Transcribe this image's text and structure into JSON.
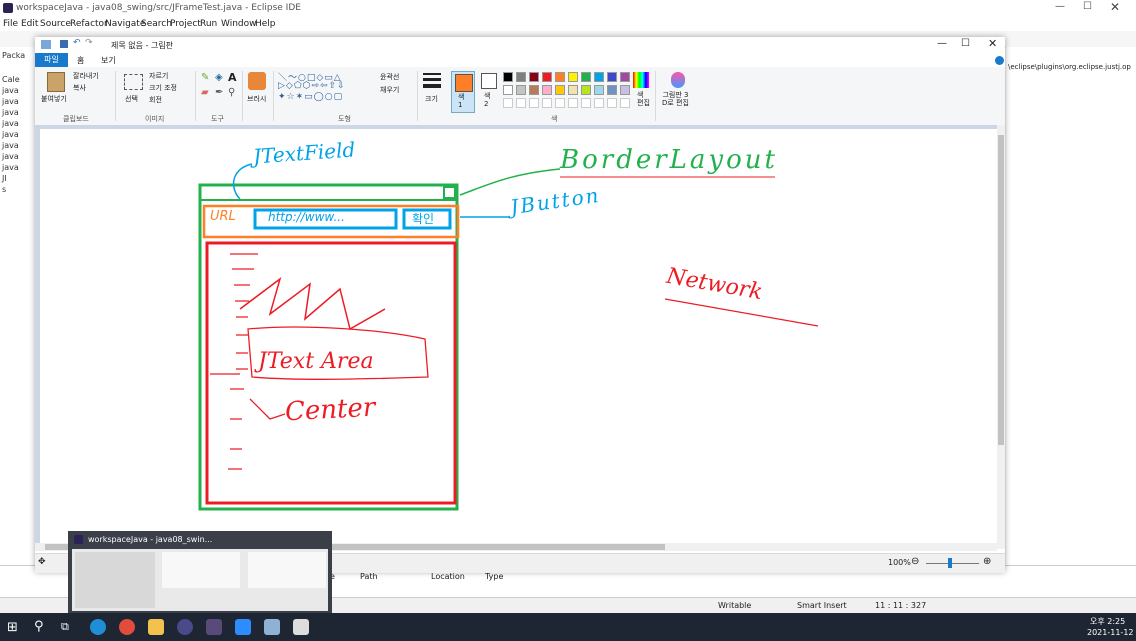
{
  "eclipse": {
    "title": "workspaceJava - java08_swing/src/JFrameTest.java - Eclipse IDE",
    "menu": [
      "File",
      "Edit",
      "Source",
      "Refactor",
      "Navigate",
      "Search",
      "Project",
      "Run",
      "Window",
      "Help"
    ],
    "package_tab": "Packa",
    "tree_items": [
      "Cale",
      "java",
      "java",
      "java",
      "java",
      "java",
      "java",
      "java",
      "java",
      "JI",
      "s"
    ],
    "right_path": "\\eclipse\\plugins\\org.eclipse.justj.op",
    "bottom_headers": [
      "e",
      "Path",
      "Location",
      "Type"
    ],
    "status": {
      "writable": "Writable",
      "insert": "Smart Insert",
      "position": "11 : 11 : 327"
    }
  },
  "paint": {
    "title": "제목 없음 - 그림판",
    "tabs": [
      "파일",
      "홈",
      "보기"
    ],
    "clipboard": {
      "paste": "붙여넣기",
      "cut": "잘라내기",
      "copy": "복사",
      "label": "클립보드"
    },
    "image": {
      "select": "선택",
      "crop": "자르기",
      "resize": "크기 조정",
      "rotate": "회전",
      "label": "이미지"
    },
    "tools_label": "도구",
    "brushes": "브러시",
    "shapes": {
      "outline": "윤곽선",
      "fill": "채우기",
      "label": "도형"
    },
    "size": "크기",
    "color1": "색\n1",
    "color2": "색\n2",
    "edit_colors": "색\n편집",
    "paint3d": "그림판 3\nD로 편집",
    "colors_label": "색",
    "zoom": "100%",
    "palette": [
      "#000000",
      "#7f7f7f",
      "#880015",
      "#ed1c24",
      "#ff7f27",
      "#fff200",
      "#22b14c",
      "#00a2e8",
      "#3f48cc",
      "#a349a4",
      "#ffffff",
      "#c3c3c3",
      "#b97a57",
      "#ffaec9",
      "#ffc90e",
      "#efe4b0",
      "#b5e61d",
      "#99d9ea",
      "#7092be",
      "#c8bfe7"
    ],
    "accent": "#1979ca"
  },
  "drawing": {
    "jtextfield": "JTextField",
    "borderlayout": "BorderLayout",
    "jbutton": "JButton",
    "network": "Network",
    "url": "URL",
    "url_value": "http://www...",
    "button_text": "확인",
    "jtextarea": "JText Area",
    "center": "Center"
  },
  "taskbar": {
    "thumb_title": "workspaceJava - java08_swin...",
    "time": "오후 2:25",
    "date": "2021-11-12"
  }
}
